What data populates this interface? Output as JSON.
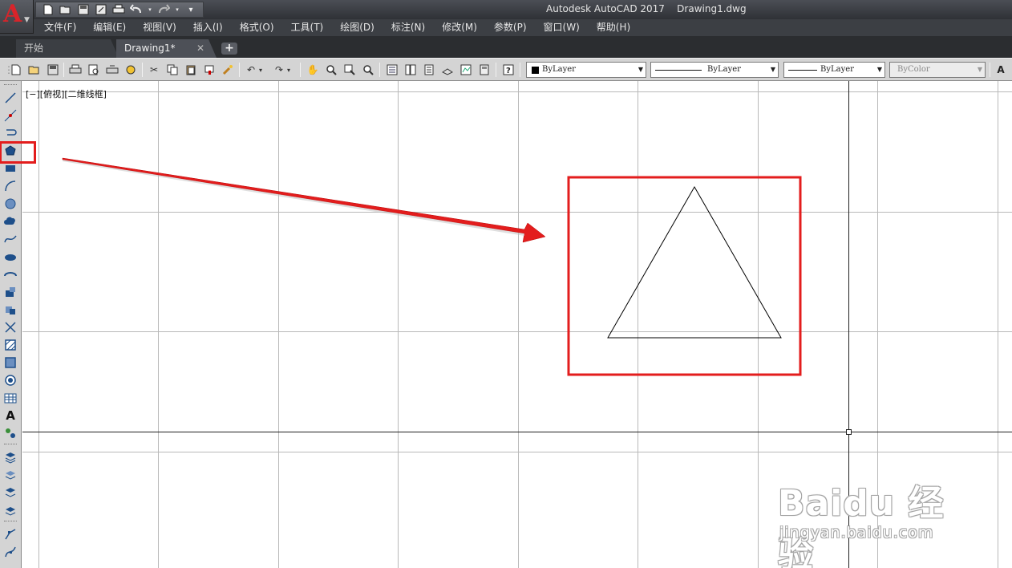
{
  "window": {
    "title": "Autodesk AutoCAD 2017    Drawing1.dwg"
  },
  "quick_access": {
    "icons": [
      "new-icon",
      "open-icon",
      "save-icon",
      "save-as-icon",
      "plot-icon",
      "undo-icon",
      "redo-icon",
      "customize-icon"
    ]
  },
  "menu": {
    "items": [
      {
        "id": "file",
        "label": "文件(F)"
      },
      {
        "id": "edit",
        "label": "编辑(E)"
      },
      {
        "id": "view",
        "label": "视图(V)"
      },
      {
        "id": "insert",
        "label": "插入(I)"
      },
      {
        "id": "format",
        "label": "格式(O)"
      },
      {
        "id": "tools",
        "label": "工具(T)"
      },
      {
        "id": "draw",
        "label": "绘图(D)"
      },
      {
        "id": "dimension",
        "label": "标注(N)"
      },
      {
        "id": "modify",
        "label": "修改(M)"
      },
      {
        "id": "parametric",
        "label": "参数(P)"
      },
      {
        "id": "window",
        "label": "窗口(W)"
      },
      {
        "id": "help",
        "label": "帮助(H)"
      }
    ]
  },
  "tabs": {
    "start": "开始",
    "drawing": "Drawing1*",
    "close_glyph": "✕",
    "add_glyph": "+"
  },
  "toolbar": {
    "color": "ByLayer",
    "linetype": "ByLayer",
    "lineweight": "ByLayer",
    "plotstyle": "ByColor"
  },
  "viewport": {
    "label": "[−][俯视][二维线框]"
  },
  "canvas": {
    "shape": "triangle",
    "highlight_color": "#e31d1d",
    "grid_color": "#b9b9b9",
    "axis_color": "#222222"
  },
  "watermark": {
    "brand": "Baidu 经验",
    "domain": "jingyan.baidu.com"
  },
  "colors": {
    "title_bar": "#3a3c41",
    "menu_bar": "#3c3f44",
    "toolbar": "#d4d4d4",
    "accent_red": "#d8242a"
  }
}
